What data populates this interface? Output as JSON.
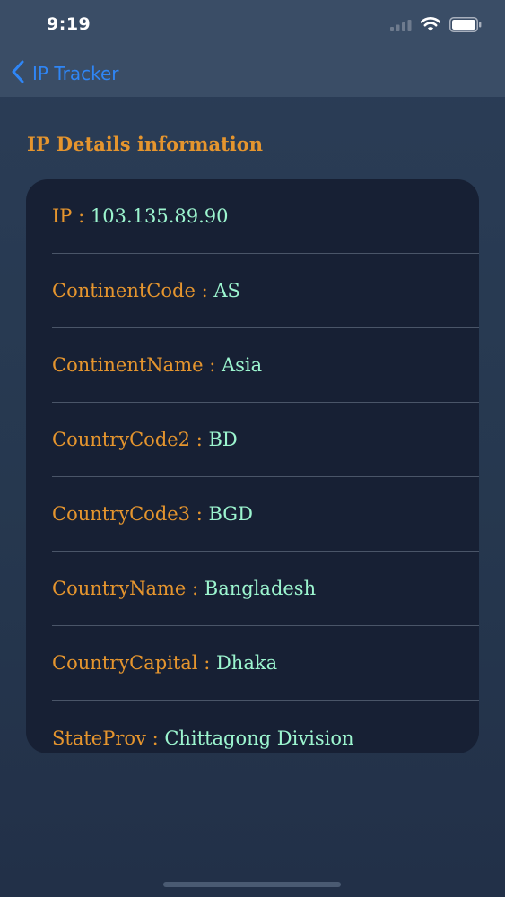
{
  "status_bar": {
    "time": "9:19",
    "icons": [
      "cellular-signal-icon",
      "wifi-icon",
      "battery-icon"
    ]
  },
  "nav": {
    "back_label": "IP Tracker",
    "back_icon": "chevron-left-icon"
  },
  "section_title": "IP Details information",
  "colors": {
    "key": "#e5952e",
    "value": "#9cf5cf",
    "accent": "#2f86f6",
    "card": "#172034"
  },
  "details": [
    {
      "key": "IP",
      "sep": " : ",
      "value": "103.135.89.90"
    },
    {
      "key": "ContinentCode",
      "sep": " : ",
      "value": "AS"
    },
    {
      "key": "ContinentName",
      "sep": " : ",
      "value": "Asia"
    },
    {
      "key": "CountryCode2",
      "sep": " : ",
      "value": "BD"
    },
    {
      "key": "CountryCode3",
      "sep": " : ",
      "value": "BGD"
    },
    {
      "key": "CountryName",
      "sep": " : ",
      "value": "Bangladesh"
    },
    {
      "key": "CountryCapital",
      "sep": " : ",
      "value": "Dhaka"
    },
    {
      "key": "StateProv",
      "sep": " : ",
      "value": "Chittagong Division"
    }
  ]
}
